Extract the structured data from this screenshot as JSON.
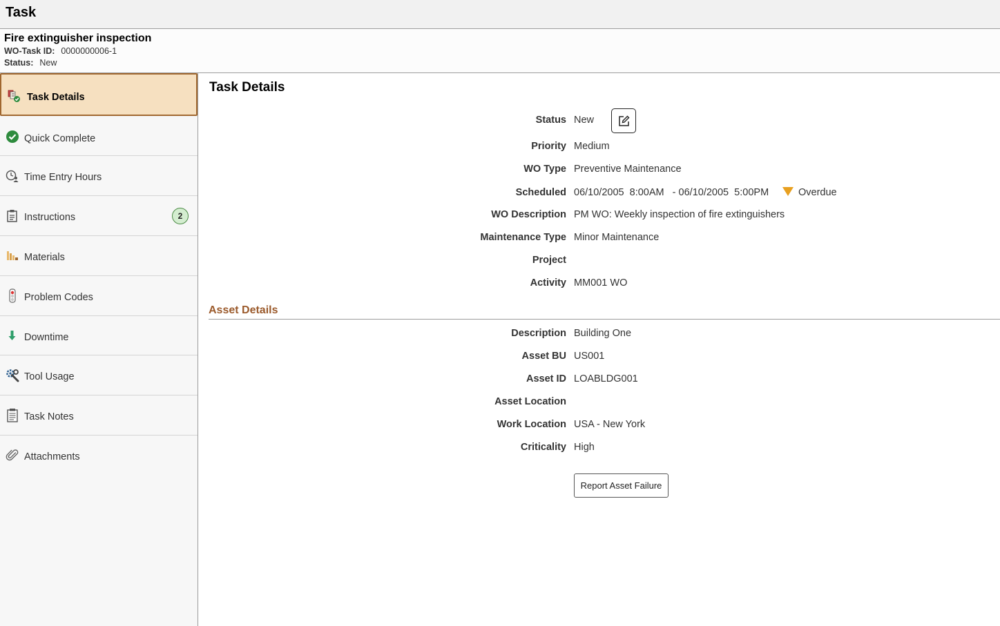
{
  "app": {
    "title": "Task"
  },
  "header": {
    "task_title": "Fire extinguisher inspection",
    "wo_task_id_label": "WO-Task ID:",
    "wo_task_id": "0000000006-1",
    "status_label": "Status:",
    "status": "New"
  },
  "sidebar": {
    "items": [
      {
        "label": "Task Details",
        "icon": "task-details-icon",
        "active": true
      },
      {
        "label": "Quick Complete",
        "icon": "check-circle-icon"
      },
      {
        "label": "Time Entry Hours",
        "icon": "clock-person-icon"
      },
      {
        "label": "Instructions",
        "icon": "clipboard-icon",
        "badge": "2"
      },
      {
        "label": "Materials",
        "icon": "materials-icon"
      },
      {
        "label": "Problem Codes",
        "icon": "traffic-light-icon"
      },
      {
        "label": "Downtime",
        "icon": "arrow-down-icon"
      },
      {
        "label": "Tool Usage",
        "icon": "wrench-gear-icon"
      },
      {
        "label": "Task Notes",
        "icon": "notes-icon"
      },
      {
        "label": "Attachments",
        "icon": "paperclip-icon"
      }
    ]
  },
  "main": {
    "title": "Task Details",
    "fields": {
      "status": {
        "label": "Status",
        "value": "New"
      },
      "priority": {
        "label": "Priority",
        "value": "Medium"
      },
      "wo_type": {
        "label": "WO Type",
        "value": "Preventive Maintenance"
      },
      "scheduled": {
        "label": "Scheduled",
        "value": "06/10/2005  8:00AM   - 06/10/2005  5:00PM",
        "flag": "Overdue"
      },
      "wo_description": {
        "label": "WO Description",
        "value": "PM WO: Weekly inspection of fire extinguishers"
      },
      "maintenance_type": {
        "label": "Maintenance Type",
        "value": "Minor Maintenance"
      },
      "project": {
        "label": "Project",
        "value": ""
      },
      "activity": {
        "label": "Activity",
        "value": "MM001 WO"
      }
    },
    "asset_section_title": "Asset Details",
    "asset": {
      "description": {
        "label": "Description",
        "value": "Building One"
      },
      "asset_bu": {
        "label": "Asset BU",
        "value": "US001"
      },
      "asset_id": {
        "label": "Asset ID",
        "value": "LOABLDG001"
      },
      "asset_location": {
        "label": "Asset Location",
        "value": ""
      },
      "work_location": {
        "label": "Work Location",
        "value": "USA - New York"
      },
      "criticality": {
        "label": "Criticality",
        "value": "High"
      }
    },
    "report_button_label": "Report Asset Failure"
  },
  "colors": {
    "active_bg": "#f6e0c0",
    "active_border": "#a0672f",
    "section_title": "#9b5a2b",
    "overdue": "#e8a020",
    "check": "#2e8b3e"
  }
}
